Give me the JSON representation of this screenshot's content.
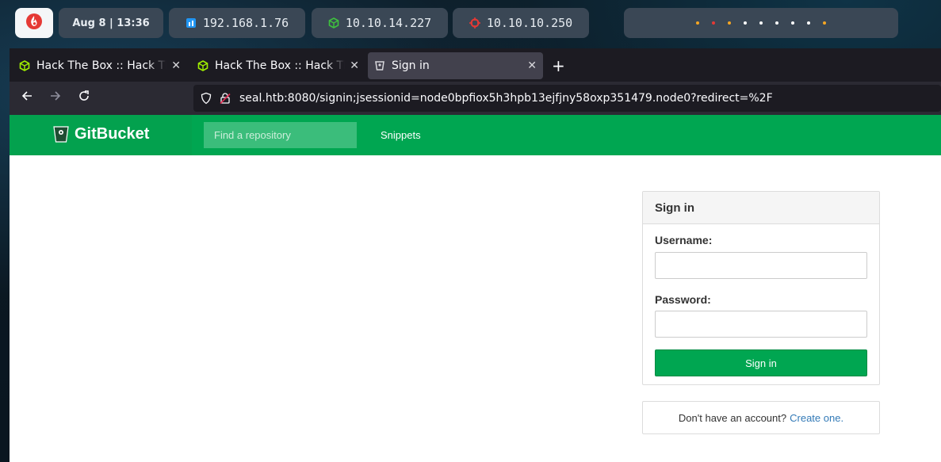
{
  "topbar": {
    "date": "Aug  8 | 13:36",
    "ip_local": "192.168.1.76",
    "ip_vpn": "10.10.14.227",
    "ip_target": "10.10.10.250",
    "dot_colors": [
      "#f5a623",
      "#e53935",
      "#f5a623",
      "#ffffff",
      "#ffffff",
      "#ffffff",
      "#ffffff",
      "#ffffff",
      "#f5a623"
    ]
  },
  "browser": {
    "tabs": [
      {
        "title": "Hack The Box :: Hack The Box",
        "icon": "htb-cube-icon"
      },
      {
        "title": "Hack The Box :: Hack The Box",
        "icon": "htb-cube-icon"
      },
      {
        "title": "Sign in",
        "icon": "gitbucket-icon"
      }
    ],
    "new_tab": "+",
    "url": "seal.htb:8080/signin;jsessionid=node0bpfiox5h3hpb13ejfjny58oxp351479.node0?redirect=%2F"
  },
  "gitbucket": {
    "brand": "GitBucket",
    "search_placeholder": "Find a repository",
    "nav_snippets": "Snippets",
    "signin": {
      "title": "Sign in",
      "username_label": "Username:",
      "password_label": "Password:",
      "button": "Sign in"
    },
    "register": {
      "text": "Don't have an account?",
      "link": "Create one."
    }
  },
  "colors": {
    "brand_green": "#00a651",
    "link_blue": "#337ab7"
  }
}
